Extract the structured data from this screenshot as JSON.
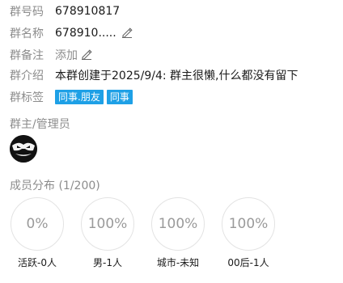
{
  "group": {
    "id_label": "群号码",
    "id_value": "678910817",
    "name_label": "群名称",
    "name_value": "678910.....",
    "remark_label": "群备注",
    "remark_value": "添加",
    "intro_label": "群介绍",
    "intro_value": "本群创建于2025/9/4:  群主很懒,什么都没有留下",
    "tags_label": "群标签",
    "tags": [
      "同事.朋友",
      "同事"
    ]
  },
  "admins": {
    "title": "群主/管理员"
  },
  "members": {
    "title": "成员分布 (1/200)",
    "stats": [
      {
        "percent": "0%",
        "caption": "活跃-0人"
      },
      {
        "percent": "100%",
        "caption": "男-1人"
      },
      {
        "percent": "100%",
        "caption": "城市-未知"
      },
      {
        "percent": "100%",
        "caption": "00后-1人"
      }
    ]
  },
  "icons": {
    "edit": "pencil-icon",
    "avatar": "owner-avatar"
  }
}
